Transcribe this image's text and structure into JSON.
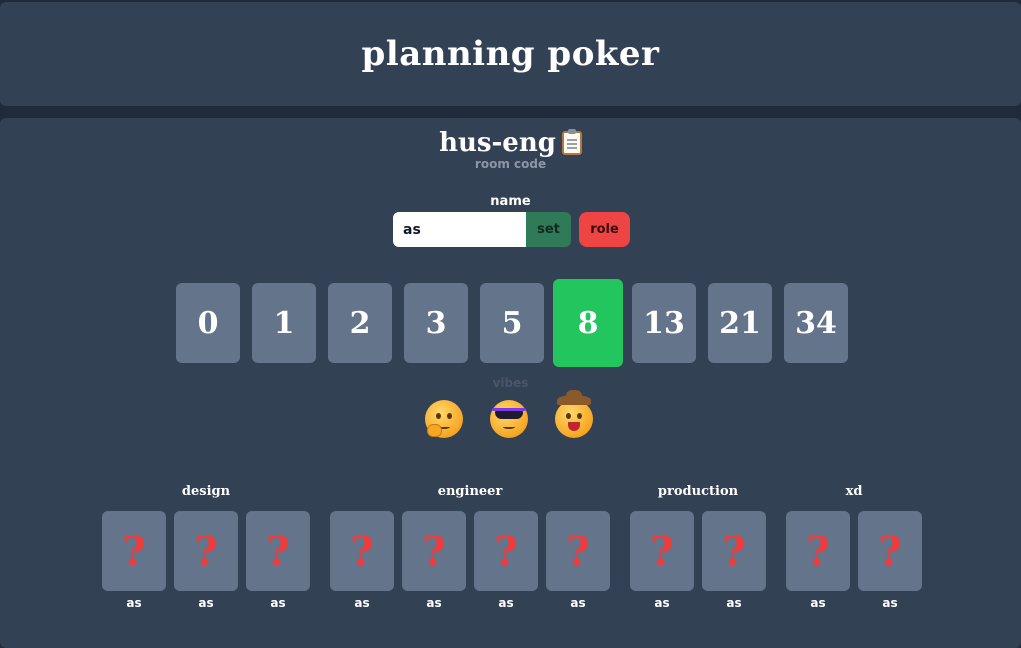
{
  "header": {
    "title": "planning poker"
  },
  "room": {
    "code": "hus-eng",
    "caption": "room code",
    "copy_icon": "clipboard-icon"
  },
  "name_form": {
    "label": "name",
    "value": "as",
    "set_label": "set",
    "role_label": "role"
  },
  "cards": [
    "0",
    "1",
    "2",
    "3",
    "5",
    "8",
    "13",
    "21",
    "34"
  ],
  "selected_card": "8",
  "vibes": {
    "label": "vibes",
    "items": [
      "thinking-face-icon",
      "cool-face-icon",
      "cowboy-face-icon"
    ]
  },
  "groups": [
    {
      "name": "design",
      "players": [
        {
          "name": "as",
          "card": "?"
        },
        {
          "name": "as",
          "card": "?"
        },
        {
          "name": "as",
          "card": "?"
        }
      ]
    },
    {
      "name": "engineer",
      "players": [
        {
          "name": "as",
          "card": "?"
        },
        {
          "name": "as",
          "card": "?"
        },
        {
          "name": "as",
          "card": "?"
        },
        {
          "name": "as",
          "card": "?"
        }
      ]
    },
    {
      "name": "production",
      "players": [
        {
          "name": "as",
          "card": "?"
        },
        {
          "name": "as",
          "card": "?"
        }
      ]
    },
    {
      "name": "xd",
      "players": [
        {
          "name": "as",
          "card": "?"
        },
        {
          "name": "as",
          "card": "?"
        }
      ]
    }
  ],
  "colors": {
    "selected_card": "#22c55e",
    "set_button": "#2f7a57",
    "role_button": "#ef4444",
    "hidden_card_mark": "#ef3b3b"
  }
}
